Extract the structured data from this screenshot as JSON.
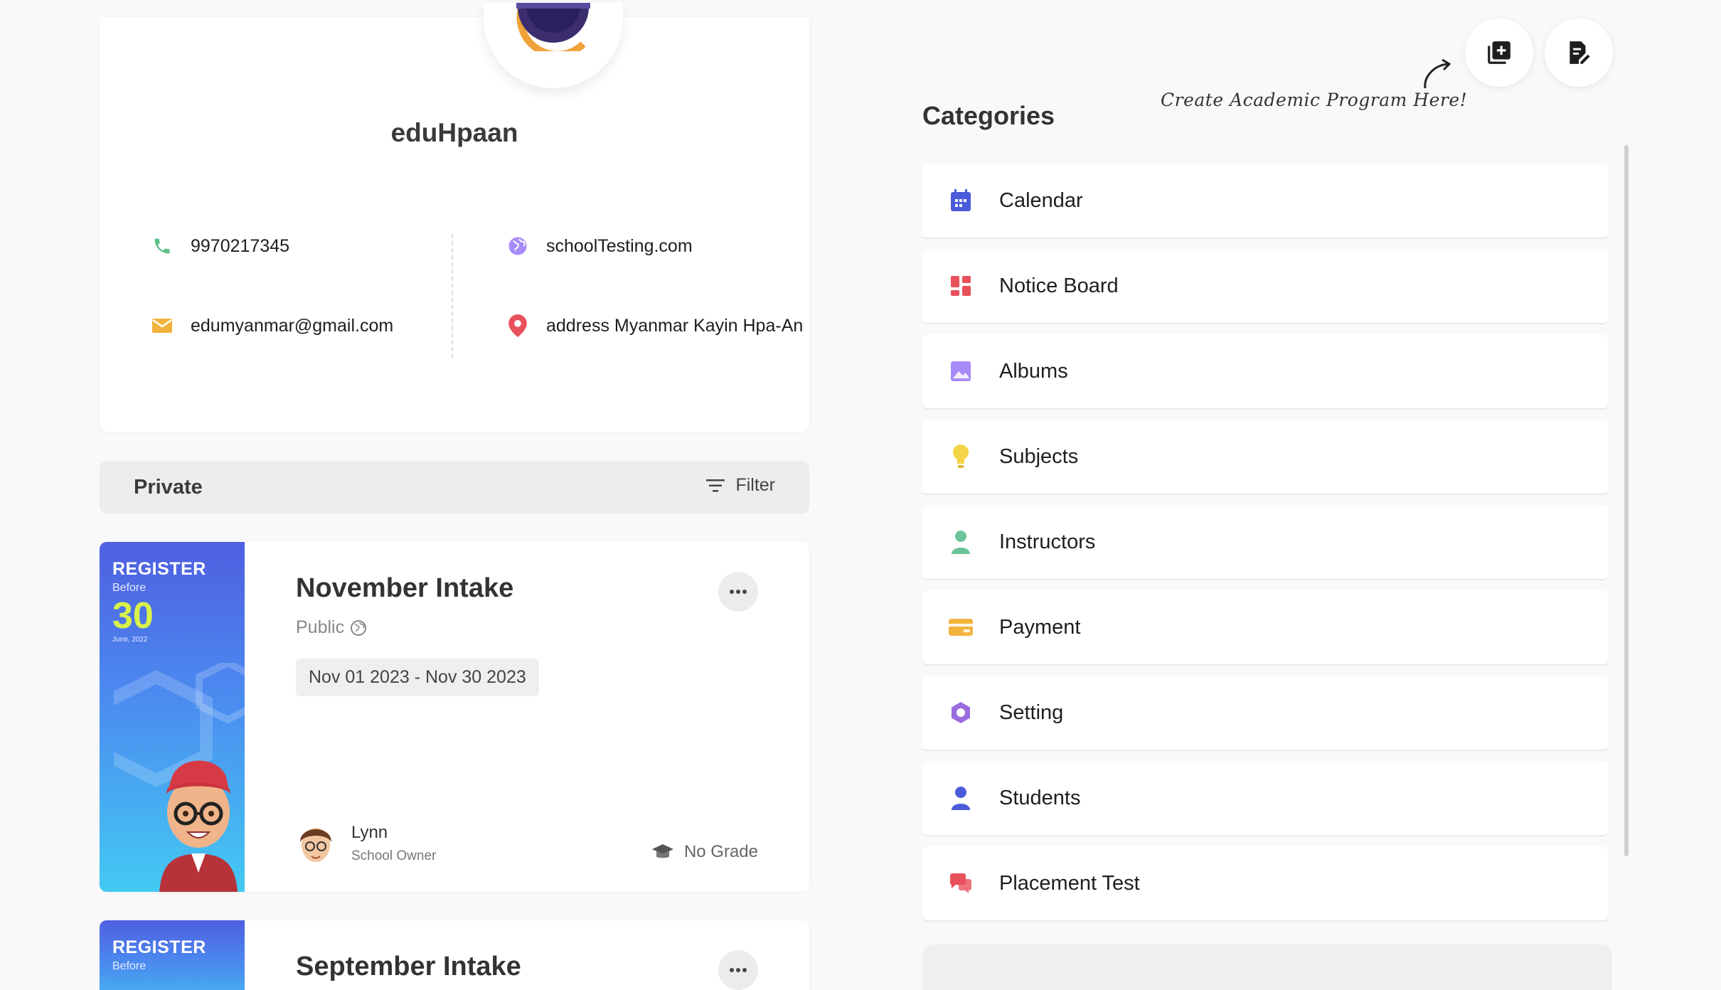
{
  "profile": {
    "name": "eduHpaan",
    "phone": "9970217345",
    "website": "schoolTesting.com",
    "email": "edumyanmar@gmail.com",
    "address": "address Myanmar Kayin Hpa-An"
  },
  "filter_bar": {
    "title": "Private",
    "filter_label": "Filter"
  },
  "programs": [
    {
      "title": "November Intake",
      "visibility": "Public",
      "date_range": "Nov 01 2023 - Nov 30 2023",
      "poster": {
        "register": "REGISTER",
        "before": "Before",
        "day": "30",
        "month": "June, 2022"
      },
      "owner_name": "Lynn",
      "owner_role": "School Owner",
      "grade": "No Grade"
    },
    {
      "title": "September Intake",
      "poster": {
        "register": "REGISTER",
        "before": "Before"
      }
    }
  ],
  "header": {
    "hint": "Create Academic Program Here!"
  },
  "categories": {
    "heading": "Categories",
    "items": [
      {
        "label": "Calendar",
        "icon": "calendar-icon",
        "color": "#4a5bd9"
      },
      {
        "label": "Notice Board",
        "icon": "notice-board-icon",
        "color": "#e8505b"
      },
      {
        "label": "Albums",
        "icon": "albums-icon",
        "color": "#a78bfa"
      },
      {
        "label": "Subjects",
        "icon": "lightbulb-icon",
        "color": "#f5d547"
      },
      {
        "label": "Instructors",
        "icon": "instructor-icon",
        "color": "#6cc29a"
      },
      {
        "label": "Payment",
        "icon": "payment-card-icon",
        "color": "#f2b33d"
      },
      {
        "label": "Setting",
        "icon": "settings-icon",
        "color": "#9b6ce0"
      },
      {
        "label": "Students",
        "icon": "student-icon",
        "color": "#4a5bd9"
      },
      {
        "label": "Placement Test",
        "icon": "chat-bubbles-icon",
        "color": "#e8505b"
      }
    ]
  }
}
